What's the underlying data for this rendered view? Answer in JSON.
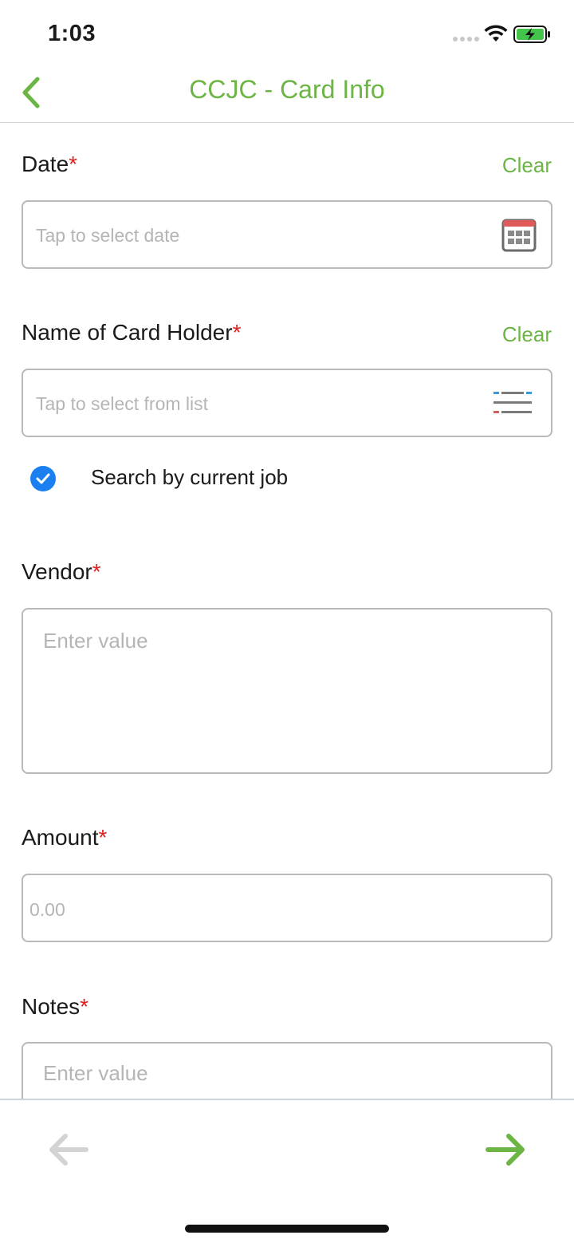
{
  "status_bar": {
    "time": "1:03"
  },
  "nav": {
    "title": "CCJC - Card Info"
  },
  "form": {
    "date": {
      "label": "Date",
      "required": "*",
      "clear": "Clear",
      "placeholder": "Tap to select date"
    },
    "card_holder": {
      "label": "Name of Card Holder",
      "required": "*",
      "clear": "Clear",
      "placeholder": "Tap to select from list",
      "search_by_job_label": "Search by current job",
      "search_by_job_checked": true
    },
    "vendor": {
      "label": "Vendor",
      "required": "*",
      "placeholder": "Enter value"
    },
    "amount": {
      "label": "Amount",
      "required": "*",
      "placeholder": "0.00"
    },
    "notes": {
      "label": "Notes",
      "required": "*",
      "placeholder": "Enter value"
    }
  },
  "colors": {
    "accent": "#6cb544",
    "required": "#e02020",
    "checkbox": "#1a80f0",
    "disabled_arrow": "#d3d3d3"
  },
  "icons": {
    "back": "chevron-left-icon",
    "date": "calendar-icon",
    "list": "list-filter-icon",
    "prev": "arrow-left-icon",
    "next": "arrow-right-icon"
  }
}
